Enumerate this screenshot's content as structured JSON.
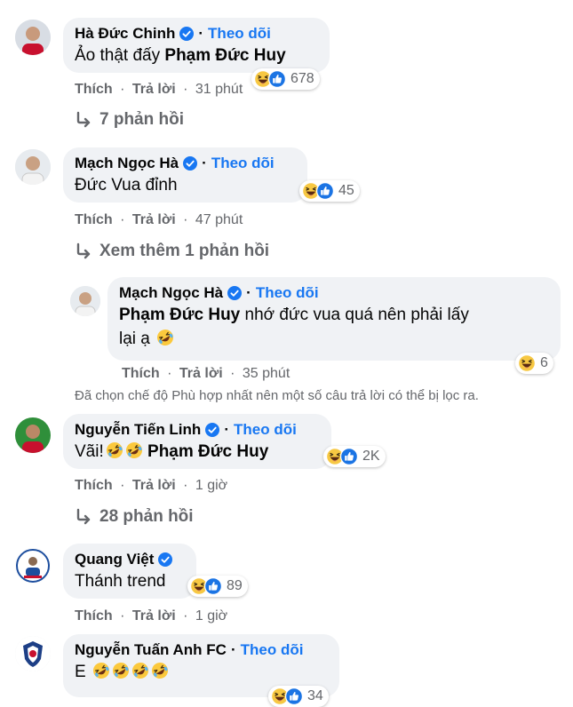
{
  "colors": {
    "accent": "#1877f2",
    "bubble": "#f0f2f5",
    "muted": "#65676b"
  },
  "comments": [
    {
      "author": "Hà Đức Chinh",
      "verified_icon": "verified-badge-icon",
      "dot": "·",
      "follow": "Theo dõi",
      "text_pre": "Ảo thật đấy ",
      "mention": "Phạm Đức Huy",
      "like": "Thích",
      "reply": "Trả lời",
      "time": "31 phút",
      "reaction_count": "678",
      "replies_label": "7 phản hồi"
    },
    {
      "author": "Mạch Ngọc Hà",
      "verified_icon": "verified-badge-icon",
      "dot": "·",
      "follow": "Theo dõi",
      "text": "Đức Vua đỉnh",
      "like": "Thích",
      "reply": "Trả lời",
      "time": "47 phút",
      "reaction_count": "45",
      "replies_label": "Xem thêm 1 phản hồi",
      "nested_reply": {
        "author": "Mạch Ngọc Hà",
        "dot": "·",
        "follow": "Theo dõi",
        "mention": "Phạm Đức Huy",
        "text_line1": " nhớ đức vua quá nên phải lấy",
        "text_line2": "lại ạ ",
        "like": "Thích",
        "reply": "Trả lời",
        "time": "35 phút",
        "reaction_count": "6"
      }
    },
    {
      "author": "Nguyễn Tiến Linh",
      "dot": "·",
      "follow": "Theo dõi",
      "text_pre": "Vãi!",
      "mention": "Phạm Đức Huy",
      "like": "Thích",
      "reply": "Trả lời",
      "time": "1 giờ",
      "reaction_count": "2K",
      "replies_label": "28 phản hồi"
    },
    {
      "author": "Quang Việt",
      "text": "Thánh trend",
      "like": "Thích",
      "reply": "Trả lời",
      "time": "1 giờ",
      "reaction_count": "89"
    },
    {
      "author": "Nguyễn Tuấn Anh FC",
      "dot": "·",
      "follow": "Theo dõi",
      "text": "E",
      "reaction_count": "34"
    }
  ],
  "filter_notice": "Đã chọn chế độ Phù hợp nhất nên một số câu trả lời có thể bị lọc ra."
}
